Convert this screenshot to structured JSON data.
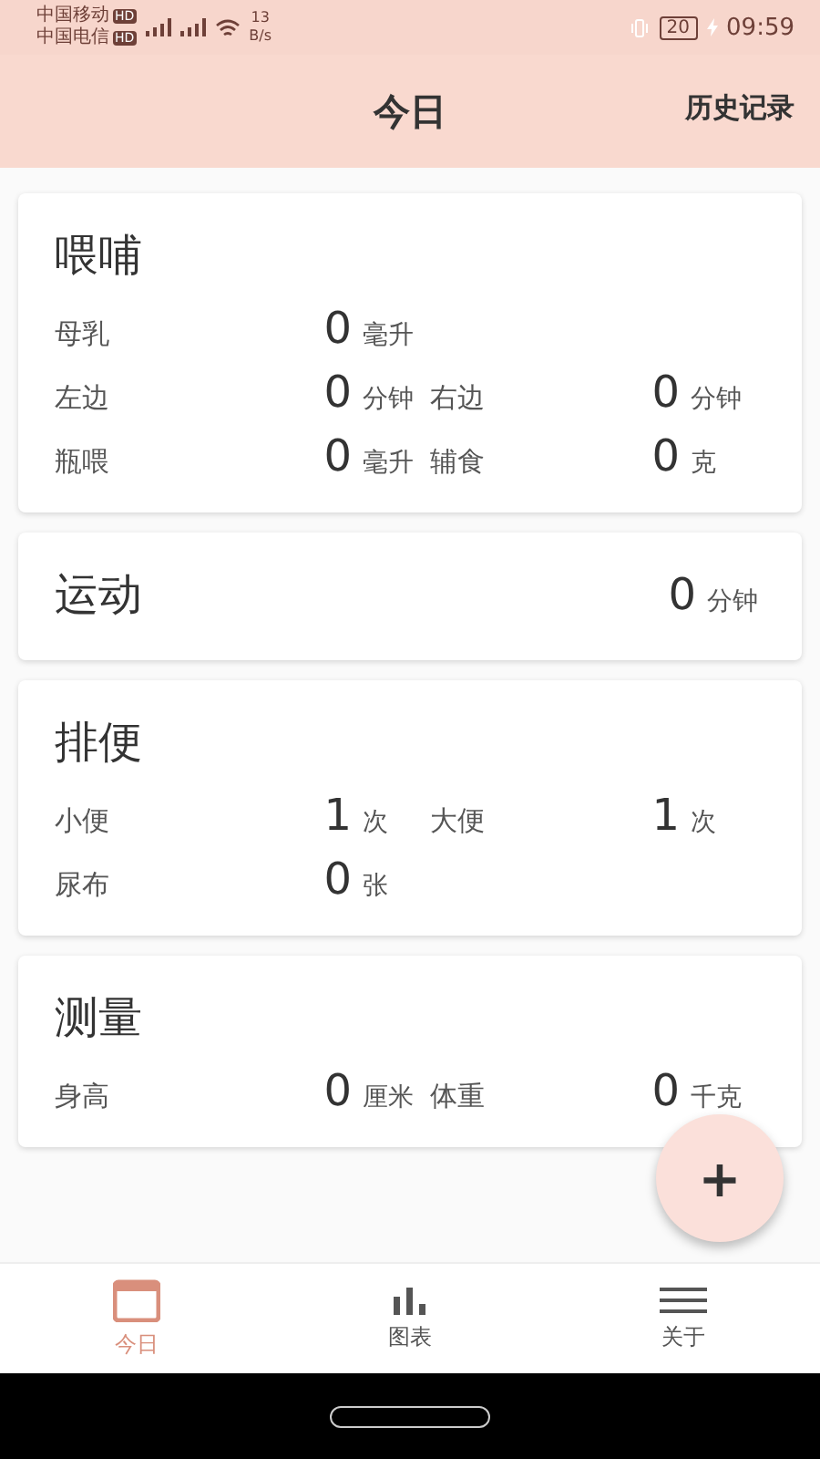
{
  "status_bar": {
    "carriers": [
      {
        "name": "中国移动",
        "badge": "HD"
      },
      {
        "name": "中国电信",
        "badge": "HD"
      }
    ],
    "speed_value": "13",
    "speed_unit": "B/s",
    "battery": "20",
    "time": "09:59"
  },
  "header": {
    "title": "今日",
    "action": "历史记录"
  },
  "sections": [
    {
      "title": "喂哺",
      "rows": [
        [
          {
            "label": "母乳",
            "value": "0",
            "unit": "毫升"
          }
        ],
        [
          {
            "label": "左边",
            "value": "0",
            "unit": "分钟"
          },
          {
            "label": "右边",
            "value": "0",
            "unit": "分钟"
          }
        ],
        [
          {
            "label": "瓶喂",
            "value": "0",
            "unit": "毫升"
          },
          {
            "label": "辅食",
            "value": "0",
            "unit": "克"
          }
        ]
      ]
    },
    {
      "title": "运动",
      "total": {
        "value": "0",
        "unit": "分钟"
      }
    },
    {
      "title": "排便",
      "rows": [
        [
          {
            "label": "小便",
            "value": "1",
            "unit": "次"
          },
          {
            "label": "大便",
            "value": "1",
            "unit": "次"
          }
        ],
        [
          {
            "label": "尿布",
            "value": "0",
            "unit": "张"
          }
        ]
      ]
    },
    {
      "title": "测量",
      "rows": [
        [
          {
            "label": "身高",
            "value": "0",
            "unit": "厘米"
          },
          {
            "label": "体重",
            "value": "0",
            "unit": "千克"
          }
        ]
      ]
    }
  ],
  "fab": {
    "label": "+"
  },
  "bottom_nav": [
    {
      "kind": "calendar",
      "label": "今日",
      "selected": true
    },
    {
      "kind": "chart",
      "label": "图表",
      "selected": false
    },
    {
      "kind": "menu",
      "label": "关于",
      "selected": false
    }
  ]
}
